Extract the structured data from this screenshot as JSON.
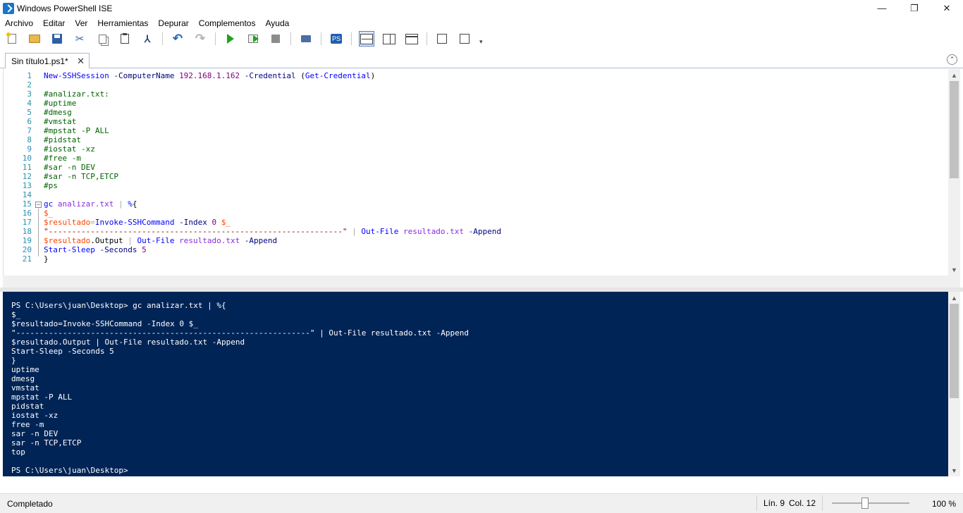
{
  "window": {
    "title": "Windows PowerShell ISE",
    "minimize": "—",
    "maximize": "❐",
    "close": "✕"
  },
  "menu": [
    "Archivo",
    "Editar",
    "Ver",
    "Herramientas",
    "Depurar",
    "Complementos",
    "Ayuda"
  ],
  "tab": {
    "label": "Sin título1.ps1*",
    "close": "✕"
  },
  "editor": {
    "line_numbers": [
      "1",
      "2",
      "3",
      "4",
      "5",
      "6",
      "7",
      "8",
      "9",
      "10",
      "11",
      "12",
      "13",
      "14",
      "15",
      "16",
      "17",
      "18",
      "19",
      "20",
      "21"
    ],
    "lines": [
      [
        [
          "cmd",
          "New-SSHSession"
        ],
        [
          "grp",
          " "
        ],
        [
          "prm",
          "-ComputerName"
        ],
        [
          "grp",
          " "
        ],
        [
          "num",
          "192.168.1.162"
        ],
        [
          "grp",
          " "
        ],
        [
          "prm",
          "-Credential"
        ],
        [
          "grp",
          " ("
        ],
        [
          "cmd",
          "Get-Credential"
        ],
        [
          "grp",
          ")"
        ]
      ],
      [],
      [
        [
          "cmt",
          "#analizar.txt:"
        ]
      ],
      [
        [
          "cmt",
          "#uptime"
        ]
      ],
      [
        [
          "cmt",
          "#dmesg"
        ]
      ],
      [
        [
          "cmt",
          "#vmstat"
        ]
      ],
      [
        [
          "cmt",
          "#mpstat -P ALL"
        ]
      ],
      [
        [
          "cmt",
          "#pidstat"
        ]
      ],
      [
        [
          "cmt",
          "#iostat -xz"
        ]
      ],
      [
        [
          "cmt",
          "#free -m"
        ]
      ],
      [
        [
          "cmt",
          "#sar -n DEV"
        ]
      ],
      [
        [
          "cmt",
          "#sar -n TCP,ETCP"
        ]
      ],
      [
        [
          "cmt",
          "#ps"
        ]
      ],
      [],
      [
        [
          "cmd",
          "gc"
        ],
        [
          "grp",
          " "
        ],
        [
          "arg",
          "analizar.txt"
        ],
        [
          "grp",
          " "
        ],
        [
          "opr",
          "|"
        ],
        [
          "grp",
          " "
        ],
        [
          "cmd",
          "%"
        ],
        [
          "grp",
          "{"
        ]
      ],
      [
        [
          "var",
          "$_"
        ]
      ],
      [
        [
          "var",
          "$resultado"
        ],
        [
          "opr",
          "="
        ],
        [
          "cmd",
          "Invoke-SSHCommand"
        ],
        [
          "grp",
          " "
        ],
        [
          "prm",
          "-Index"
        ],
        [
          "grp",
          " "
        ],
        [
          "num",
          "0"
        ],
        [
          "grp",
          " "
        ],
        [
          "var",
          "$_"
        ]
      ],
      [
        [
          "str",
          "\"---------------------------------------------------------------\""
        ],
        [
          "grp",
          " "
        ],
        [
          "opr",
          "|"
        ],
        [
          "grp",
          " "
        ],
        [
          "cmd",
          "Out-File"
        ],
        [
          "grp",
          " "
        ],
        [
          "arg",
          "resultado.txt"
        ],
        [
          "grp",
          " "
        ],
        [
          "prm",
          "-Append"
        ]
      ],
      [
        [
          "var",
          "$resultado"
        ],
        [
          "grp",
          "."
        ],
        [
          "mem",
          "Output"
        ],
        [
          "grp",
          " "
        ],
        [
          "opr",
          "|"
        ],
        [
          "grp",
          " "
        ],
        [
          "cmd",
          "Out-File"
        ],
        [
          "grp",
          " "
        ],
        [
          "arg",
          "resultado.txt"
        ],
        [
          "grp",
          " "
        ],
        [
          "prm",
          "-Append"
        ]
      ],
      [
        [
          "cmd",
          "Start-Sleep"
        ],
        [
          "grp",
          " "
        ],
        [
          "prm",
          "-Seconds"
        ],
        [
          "grp",
          " "
        ],
        [
          "num",
          "5"
        ]
      ],
      [
        [
          "grp",
          "}"
        ]
      ]
    ]
  },
  "console": {
    "lines": [
      "PS C:\\Users\\juan\\Desktop> gc analizar.txt | %{",
      "$_",
      "$resultado=Invoke-SSHCommand -Index 0 $_",
      "\"---------------------------------------------------------------\" | Out-File resultado.txt -Append",
      "$resultado.Output | Out-File resultado.txt -Append",
      "Start-Sleep -Seconds 5",
      "}",
      "uptime",
      "dmesg",
      "vmstat",
      "mpstat -P ALL",
      "pidstat",
      "iostat -xz",
      "free -m",
      "sar -n DEV",
      "sar -n TCP,ETCP",
      "top",
      "",
      "PS C:\\Users\\juan\\Desktop>"
    ]
  },
  "status": {
    "text": "Completado",
    "line": "Lín. 9",
    "col": "Col. 12",
    "zoom": "100 %",
    "zoom_level_percent": 100
  },
  "icons": {
    "ps_badge": "PS",
    "collapse": "⌃",
    "scroll_up": "▲",
    "scroll_down": "▼",
    "more": "▾",
    "cut": "✂",
    "clear": "⅄",
    "undo": "↶",
    "redo": "↷",
    "fold_open": "−"
  }
}
